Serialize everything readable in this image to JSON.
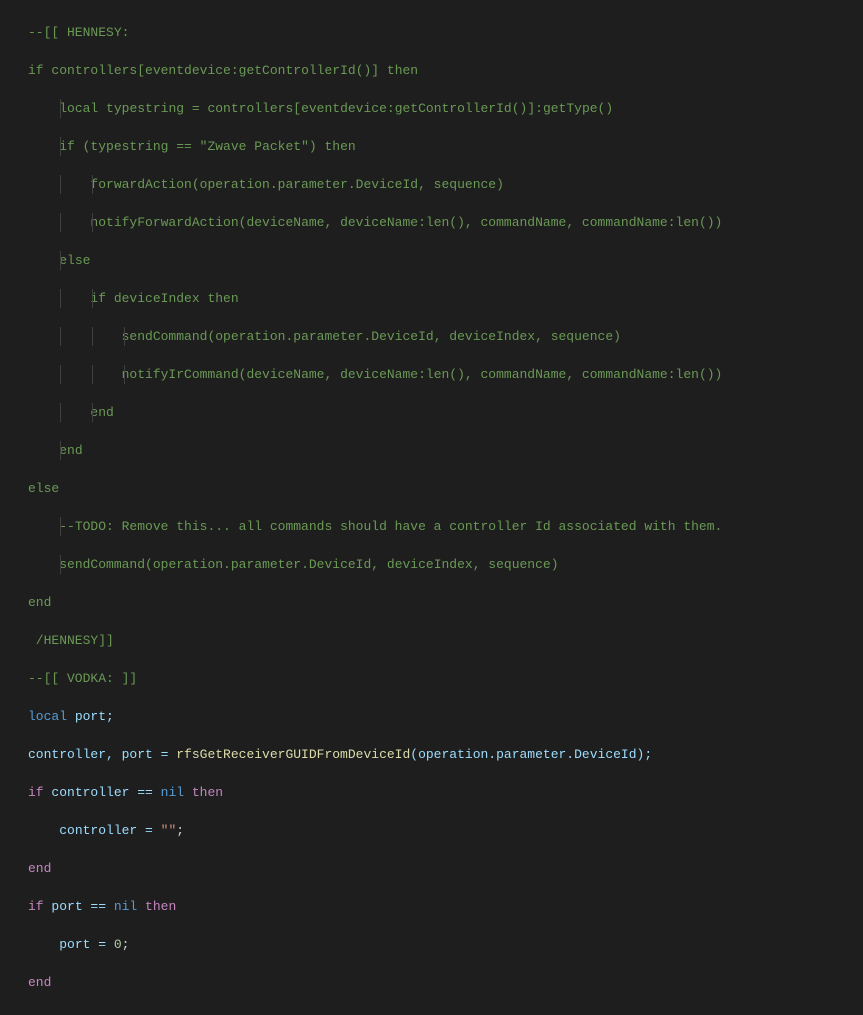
{
  "code": {
    "l1": "--[[ HENNESY:",
    "l2a": "if",
    "l2b": " controllers[eventdevice:",
    "l2c": "getControllerId",
    "l2d": "()] ",
    "l2e": "then",
    "l3a": "local",
    "l3b": " typestring = controllers[eventdevice:",
    "l3c": "getControllerId",
    "l3d": "()]:",
    "l3e": "getType",
    "l3f": "()",
    "l4a": "if",
    "l4b": " (typestring == ",
    "l4c": "\"Zwave Packet\"",
    "l4d": ") ",
    "l4e": "then",
    "l5a": "forwardAction",
    "l5b": "(operation.parameter.DeviceId, sequence)",
    "l6a": "notifyForwardAction",
    "l6b": "(deviceName, deviceName:",
    "l6c": "len",
    "l6d": "(), commandName, commandName:",
    "l6e": "len",
    "l6f": "())",
    "l7": "else",
    "l8a": "if",
    "l8b": " deviceIndex ",
    "l8c": "then",
    "l9a": "sendCommand",
    "l9b": "(operation.parameter.DeviceId, deviceIndex, sequence)",
    "l10a": "notifyIrCommand",
    "l10b": "(deviceName, deviceName:",
    "l10c": "len",
    "l10d": "(), commandName, commandName:",
    "l10e": "len",
    "l10f": "())",
    "l11": "end",
    "l12": "end",
    "l13": "else",
    "l14": "--TODO: Remove this... all commands should have a controller Id associated with them.",
    "l15a": "sendCommand",
    "l15b": "(operation.parameter.DeviceId, deviceIndex, sequence)",
    "l16": "end",
    "l17": " /HENNESY]]",
    "l18": "--[[ VODKA: ]]",
    "l19a": "local",
    "l19b": " port;",
    "l20a": "controller, port = ",
    "l20b": "rfsGetReceiverGUIDFromDeviceId",
    "l20c": "(operation.parameter.DeviceId);",
    "l21a": "if",
    "l21b": " controller == ",
    "l21c": "nil",
    "l21d": " ",
    "l21e": "then",
    "l22a": "controller = ",
    "l22b": "\"\"",
    "l22c": ";",
    "l23": "end",
    "l24a": "if",
    "l24b": " port == ",
    "l24c": "nil",
    "l24d": " ",
    "l24e": "then",
    "l25a": "port = ",
    "l25b": "0",
    "l25c": ";",
    "l26": "end"
  },
  "colors": {
    "background": "#1e1e1e",
    "comment": "#6a9955",
    "keyword": "#c586c0",
    "keyword2": "#569cd6",
    "function": "#dcdcaa",
    "identifier": "#9cdcfe",
    "string": "#ce9178",
    "number": "#b5cea8",
    "default": "#d4d4d4"
  }
}
